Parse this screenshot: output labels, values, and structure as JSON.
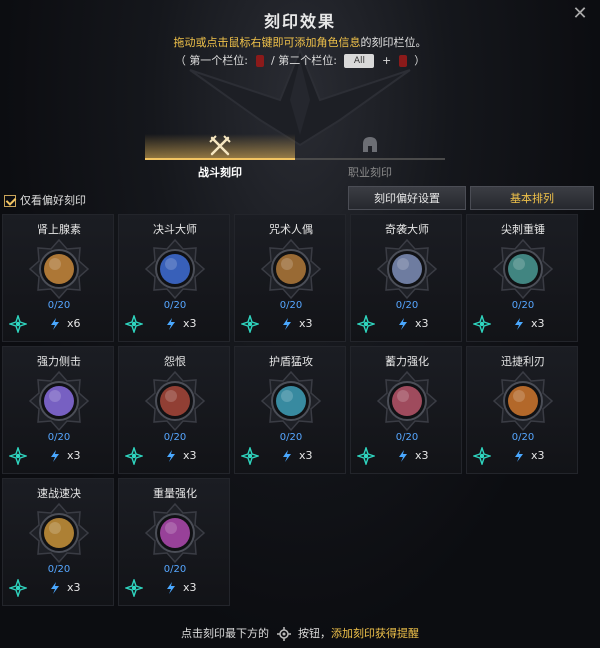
{
  "window": {
    "title": "刻印效果"
  },
  "hint": {
    "part1": "拖动或点击鼠标右键即可添加角色信息",
    "part2": "的刻印栏位。"
  },
  "slots": {
    "open": "（",
    "first_label": "第一个栏位:",
    "sep": "/",
    "second_label": "第二个栏位:",
    "select_value": "All",
    "plus": "+",
    "close": "）"
  },
  "tabs": [
    {
      "label": "战斗刻印",
      "icon": "crossed-swords-icon",
      "active": true
    },
    {
      "label": "职业刻印",
      "icon": "helmet-icon",
      "active": false
    }
  ],
  "filter": {
    "label": "仅看偏好刻印",
    "checked": true
  },
  "buttons": {
    "preference": "刻印偏好设置",
    "sort": "基本排列"
  },
  "engravings": [
    {
      "name": "肾上腺素",
      "progress": "0/20",
      "count": "x6",
      "color": "#c98a3c"
    },
    {
      "name": "决斗大师",
      "progress": "0/20",
      "count": "x3",
      "color": "#3f6fd6"
    },
    {
      "name": "咒术人偶",
      "progress": "0/20",
      "count": "x3",
      "color": "#b27a3a"
    },
    {
      "name": "奇袭大师",
      "progress": "0/20",
      "count": "x3",
      "color": "#7f8fb8"
    },
    {
      "name": "尖刺重锤",
      "progress": "0/20",
      "count": "x3",
      "color": "#4a9a94"
    },
    {
      "name": "强力侧击",
      "progress": "0/20",
      "count": "x3",
      "color": "#8a6fe0"
    },
    {
      "name": "怨恨",
      "progress": "0/20",
      "count": "x3",
      "color": "#a8483a"
    },
    {
      "name": "护盾猛攻",
      "progress": "0/20",
      "count": "x3",
      "color": "#3fa0b8"
    },
    {
      "name": "蓄力强化",
      "progress": "0/20",
      "count": "x3",
      "color": "#b8566a"
    },
    {
      "name": "迅捷利刃",
      "progress": "0/20",
      "count": "x3",
      "color": "#d0782e"
    },
    {
      "name": "速战速决",
      "progress": "0/20",
      "count": "x3",
      "color": "#c9943a"
    },
    {
      "name": "重量强化",
      "progress": "0/20",
      "count": "x3",
      "color": "#b04ab0"
    }
  ],
  "footer": {
    "part1": "点击刻印最下方的",
    "part2": "按钮，",
    "highlight": "添加刻印获得提醒"
  },
  "colors": {
    "accent": "#f0c24a",
    "progress": "#56a6ff",
    "add_icon": "#2fd6c0",
    "bolt": "#4aa8ff"
  }
}
